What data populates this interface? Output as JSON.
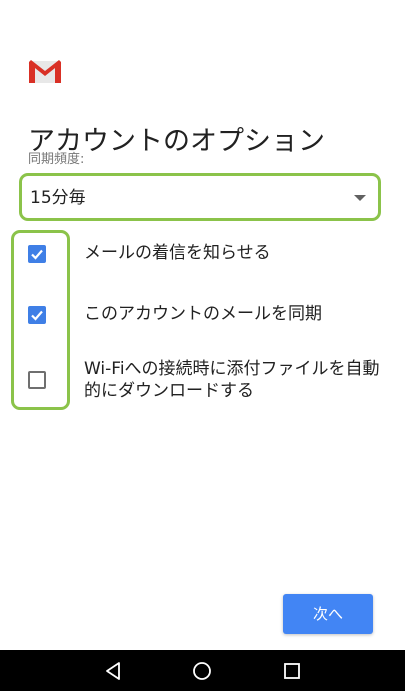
{
  "header": {
    "logo_icon": "gmail-m-logo",
    "title": "アカウントのオプション"
  },
  "sync": {
    "label": "同期頻度:",
    "value": "15分毎"
  },
  "options": [
    {
      "label": "メールの着信を知らせる",
      "checked": true
    },
    {
      "label": "このアカウントのメールを同期",
      "checked": true
    },
    {
      "label": "Wi-Fiへの接続時に添付ファイルを自動的にダウンロードする",
      "checked": false
    }
  ],
  "footer": {
    "next_label": "次へ"
  },
  "nav": {
    "back_icon": "triangle-back-icon",
    "home_icon": "circle-home-icon",
    "recent_icon": "square-recent-icon"
  },
  "colors": {
    "accent": "#4285f4",
    "checkbox": "#3f7fe6",
    "highlight": "#8bc34a",
    "gmail_red": "#d93025"
  }
}
